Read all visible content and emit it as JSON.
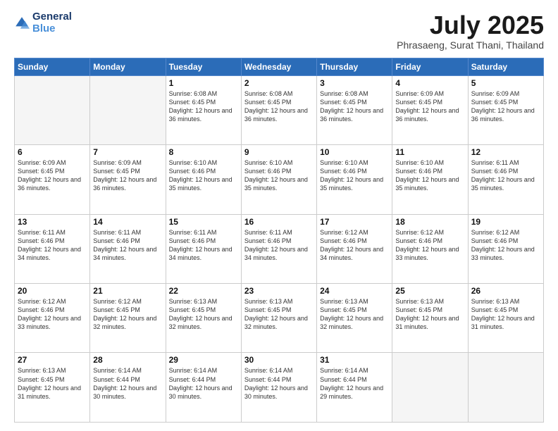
{
  "logo": {
    "line1": "General",
    "line2": "Blue"
  },
  "title": "July 2025",
  "subtitle": "Phrasaeng, Surat Thani, Thailand",
  "days_of_week": [
    "Sunday",
    "Monday",
    "Tuesday",
    "Wednesday",
    "Thursday",
    "Friday",
    "Saturday"
  ],
  "weeks": [
    [
      {
        "day": "",
        "info": ""
      },
      {
        "day": "",
        "info": ""
      },
      {
        "day": "1",
        "info": "Sunrise: 6:08 AM\nSunset: 6:45 PM\nDaylight: 12 hours and 36 minutes."
      },
      {
        "day": "2",
        "info": "Sunrise: 6:08 AM\nSunset: 6:45 PM\nDaylight: 12 hours and 36 minutes."
      },
      {
        "day": "3",
        "info": "Sunrise: 6:08 AM\nSunset: 6:45 PM\nDaylight: 12 hours and 36 minutes."
      },
      {
        "day": "4",
        "info": "Sunrise: 6:09 AM\nSunset: 6:45 PM\nDaylight: 12 hours and 36 minutes."
      },
      {
        "day": "5",
        "info": "Sunrise: 6:09 AM\nSunset: 6:45 PM\nDaylight: 12 hours and 36 minutes."
      }
    ],
    [
      {
        "day": "6",
        "info": "Sunrise: 6:09 AM\nSunset: 6:45 PM\nDaylight: 12 hours and 36 minutes."
      },
      {
        "day": "7",
        "info": "Sunrise: 6:09 AM\nSunset: 6:45 PM\nDaylight: 12 hours and 36 minutes."
      },
      {
        "day": "8",
        "info": "Sunrise: 6:10 AM\nSunset: 6:46 PM\nDaylight: 12 hours and 35 minutes."
      },
      {
        "day": "9",
        "info": "Sunrise: 6:10 AM\nSunset: 6:46 PM\nDaylight: 12 hours and 35 minutes."
      },
      {
        "day": "10",
        "info": "Sunrise: 6:10 AM\nSunset: 6:46 PM\nDaylight: 12 hours and 35 minutes."
      },
      {
        "day": "11",
        "info": "Sunrise: 6:10 AM\nSunset: 6:46 PM\nDaylight: 12 hours and 35 minutes."
      },
      {
        "day": "12",
        "info": "Sunrise: 6:11 AM\nSunset: 6:46 PM\nDaylight: 12 hours and 35 minutes."
      }
    ],
    [
      {
        "day": "13",
        "info": "Sunrise: 6:11 AM\nSunset: 6:46 PM\nDaylight: 12 hours and 34 minutes."
      },
      {
        "day": "14",
        "info": "Sunrise: 6:11 AM\nSunset: 6:46 PM\nDaylight: 12 hours and 34 minutes."
      },
      {
        "day": "15",
        "info": "Sunrise: 6:11 AM\nSunset: 6:46 PM\nDaylight: 12 hours and 34 minutes."
      },
      {
        "day": "16",
        "info": "Sunrise: 6:11 AM\nSunset: 6:46 PM\nDaylight: 12 hours and 34 minutes."
      },
      {
        "day": "17",
        "info": "Sunrise: 6:12 AM\nSunset: 6:46 PM\nDaylight: 12 hours and 34 minutes."
      },
      {
        "day": "18",
        "info": "Sunrise: 6:12 AM\nSunset: 6:46 PM\nDaylight: 12 hours and 33 minutes."
      },
      {
        "day": "19",
        "info": "Sunrise: 6:12 AM\nSunset: 6:46 PM\nDaylight: 12 hours and 33 minutes."
      }
    ],
    [
      {
        "day": "20",
        "info": "Sunrise: 6:12 AM\nSunset: 6:46 PM\nDaylight: 12 hours and 33 minutes."
      },
      {
        "day": "21",
        "info": "Sunrise: 6:12 AM\nSunset: 6:45 PM\nDaylight: 12 hours and 32 minutes."
      },
      {
        "day": "22",
        "info": "Sunrise: 6:13 AM\nSunset: 6:45 PM\nDaylight: 12 hours and 32 minutes."
      },
      {
        "day": "23",
        "info": "Sunrise: 6:13 AM\nSunset: 6:45 PM\nDaylight: 12 hours and 32 minutes."
      },
      {
        "day": "24",
        "info": "Sunrise: 6:13 AM\nSunset: 6:45 PM\nDaylight: 12 hours and 32 minutes."
      },
      {
        "day": "25",
        "info": "Sunrise: 6:13 AM\nSunset: 6:45 PM\nDaylight: 12 hours and 31 minutes."
      },
      {
        "day": "26",
        "info": "Sunrise: 6:13 AM\nSunset: 6:45 PM\nDaylight: 12 hours and 31 minutes."
      }
    ],
    [
      {
        "day": "27",
        "info": "Sunrise: 6:13 AM\nSunset: 6:45 PM\nDaylight: 12 hours and 31 minutes."
      },
      {
        "day": "28",
        "info": "Sunrise: 6:14 AM\nSunset: 6:44 PM\nDaylight: 12 hours and 30 minutes."
      },
      {
        "day": "29",
        "info": "Sunrise: 6:14 AM\nSunset: 6:44 PM\nDaylight: 12 hours and 30 minutes."
      },
      {
        "day": "30",
        "info": "Sunrise: 6:14 AM\nSunset: 6:44 PM\nDaylight: 12 hours and 30 minutes."
      },
      {
        "day": "31",
        "info": "Sunrise: 6:14 AM\nSunset: 6:44 PM\nDaylight: 12 hours and 29 minutes."
      },
      {
        "day": "",
        "info": ""
      },
      {
        "day": "",
        "info": ""
      }
    ]
  ]
}
